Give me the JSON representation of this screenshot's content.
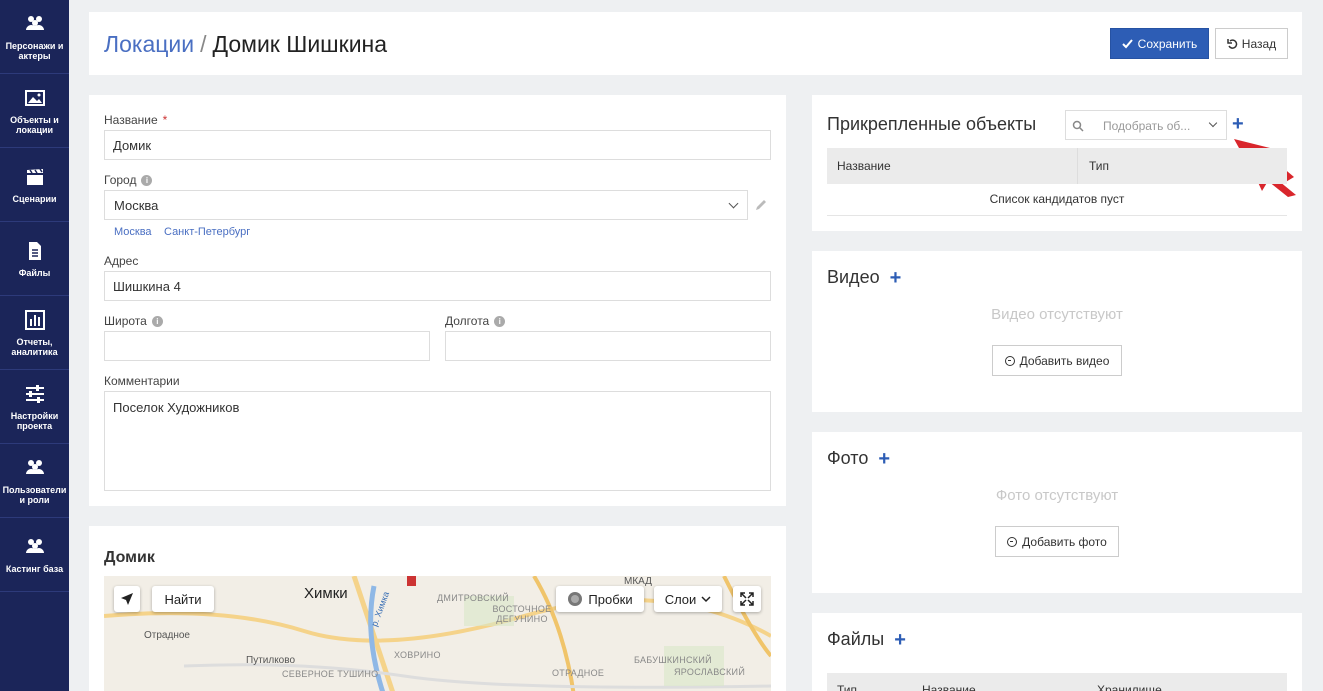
{
  "sidebar": {
    "items": [
      {
        "label": "Персонажи и актеры",
        "icon": "people-icon"
      },
      {
        "label": "Объекты и локации",
        "icon": "image-icon"
      },
      {
        "label": "Сценарии",
        "icon": "clapperboard-icon"
      },
      {
        "label": "Файлы",
        "icon": "file-icon"
      },
      {
        "label": "Отчеты, аналитика",
        "icon": "chart-icon"
      },
      {
        "label": "Настройки проекта",
        "icon": "sliders-icon"
      },
      {
        "label": "Пользователи и роли",
        "icon": "people-icon"
      },
      {
        "label": "Кастинг база",
        "icon": "people-icon"
      }
    ]
  },
  "header": {
    "breadcrumb_link": "Локации",
    "separator": "/",
    "title": "Домик Шишкина",
    "save_label": "Сохранить",
    "back_label": "Назад"
  },
  "form": {
    "name_label": "Название",
    "name_required": "*",
    "name_value": "Домик",
    "city_label": "Город",
    "city_value": "Москва",
    "city_quick": [
      "Москва",
      "Санкт-Петербург"
    ],
    "address_label": "Адрес",
    "address_value": "Шишкина 4",
    "lat_label": "Широта",
    "lat_value": "",
    "lon_label": "Долгота",
    "lon_value": "",
    "comments_label": "Комментарии",
    "comments_value": "Поселок Художников"
  },
  "map": {
    "title": "Домик",
    "find_label": "Найти",
    "traffic_label": "Пробки",
    "layers_label": "Слои",
    "labels": {
      "khimki": "Химки",
      "otradnoe1": "Отрадное",
      "putilkovo": "Путилково",
      "tushino": "СЕВЕРНОЕ ТУШИНО",
      "khovrino": "ХОВРИНО",
      "dmitrovsky": "ДМИТРОВСКИЙ",
      "degunino": "ВОСТОЧНОЕ ДЕГУНИНО",
      "otradnoe2": "ОТРАДНОЕ",
      "babushkinsky": "БАБУШКИНСКИЙ",
      "yaroslavsky": "ЯРОСЛАВСКИЙ",
      "mkad": "МКАД",
      "river_khimka": "р. Химка"
    }
  },
  "attached": {
    "title": "Прикрепленные объекты",
    "search_placeholder": "Подобрать об...",
    "col_name": "Название",
    "col_type": "Тип",
    "empty": "Список кандидатов пуст"
  },
  "video": {
    "title": "Видео",
    "absent": "Видео отсутствуют",
    "add_label": "Добавить видео"
  },
  "photo": {
    "title": "Фото",
    "absent": "Фото отсутствуют",
    "add_label": "Добавить фото"
  },
  "files": {
    "title": "Файлы",
    "col_type": "Тип",
    "col_name": "Название",
    "col_storage": "Хранилище"
  },
  "colors": {
    "sidebar": "#1b2559",
    "accent": "#2d5db5",
    "link": "#4a6fc2",
    "hint_arrow": "#d9262c"
  }
}
